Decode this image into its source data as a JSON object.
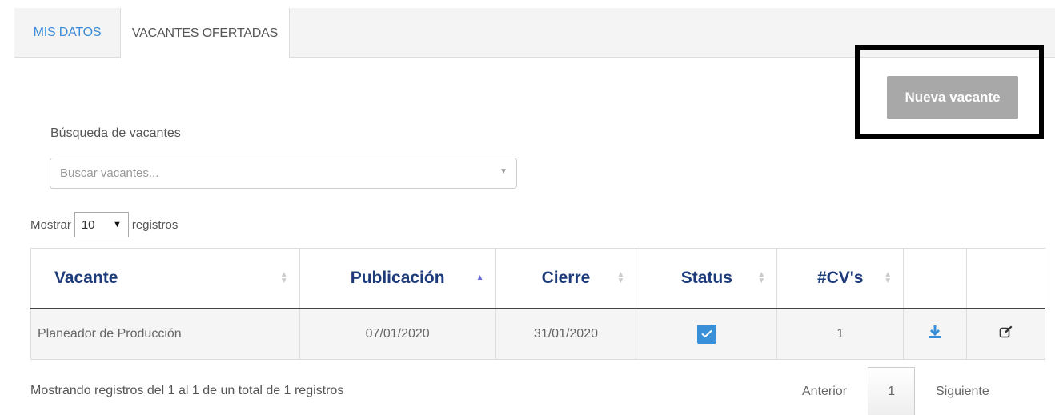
{
  "tabs": [
    {
      "label": "MIS DATOS",
      "active": false
    },
    {
      "label": "VACANTES OFERTADAS",
      "active": true
    }
  ],
  "new_button_label": "Nueva vacante",
  "search": {
    "label": "Búsqueda de vacantes",
    "placeholder": "Buscar vacantes..."
  },
  "length_control": {
    "prefix": "Mostrar",
    "selected": "10",
    "suffix": "registros"
  },
  "table": {
    "headers": [
      "Vacante",
      "Publicación",
      "Cierre",
      "Status",
      "#CV's",
      "",
      ""
    ],
    "sorted_column": "Publicación",
    "rows": [
      {
        "vacante": "Planeador de Producción",
        "publicacion": "07/01/2020",
        "cierre": "31/01/2020",
        "status_checked": true,
        "cvs": "1",
        "download_icon": "download-icon",
        "edit_icon": "edit-icon"
      }
    ]
  },
  "info_text": "Mostrando registros del 1 al 1 de un total de 1 registros",
  "pagination": {
    "previous": "Anterior",
    "current_page": "1",
    "next": "Siguiente"
  },
  "colors": {
    "accent": "#3a8fd9",
    "header_text": "#1d3b7a",
    "button_bg": "#a8a8a8"
  }
}
